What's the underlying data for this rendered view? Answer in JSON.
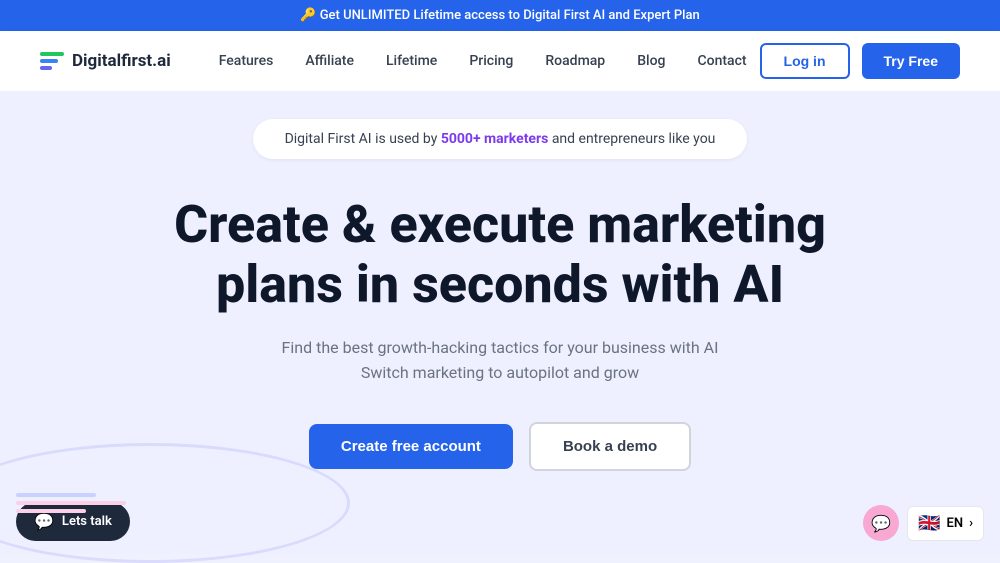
{
  "banner": {
    "icon": "🔑",
    "text": "Get UNLIMITED Lifetime access  to Digital First AI and Expert Plan"
  },
  "navbar": {
    "logo_text": "Digitalfirst.ai",
    "links": [
      {
        "label": "Features",
        "id": "features"
      },
      {
        "label": "Affiliate",
        "id": "affiliate"
      },
      {
        "label": "Lifetime",
        "id": "lifetime"
      },
      {
        "label": "Pricing",
        "id": "pricing"
      },
      {
        "label": "Roadmap",
        "id": "roadmap"
      },
      {
        "label": "Blog",
        "id": "blog"
      },
      {
        "label": "Contact",
        "id": "contact"
      }
    ],
    "login_label": "Log in",
    "try_label": "Try Free"
  },
  "social_proof": {
    "prefix": "Digital First AI is used by ",
    "highlight": "5000+ marketers",
    "suffix": " and entrepreneurs like you"
  },
  "hero": {
    "title": "Create & execute marketing plans in seconds with AI",
    "subtitle_line1": "Find the best growth-hacking tactics for your business with AI",
    "subtitle_line2": "Switch marketing to autopilot and grow"
  },
  "cta": {
    "create_label": "Create free account",
    "demo_label": "Book a demo"
  },
  "chat": {
    "label": "Lets talk"
  },
  "language": {
    "code": "EN",
    "flag": "🇬🇧"
  },
  "colors": {
    "blue": "#2563eb",
    "purple": "#7c3aed",
    "dark": "#0f172a",
    "gray": "#6b7280"
  }
}
